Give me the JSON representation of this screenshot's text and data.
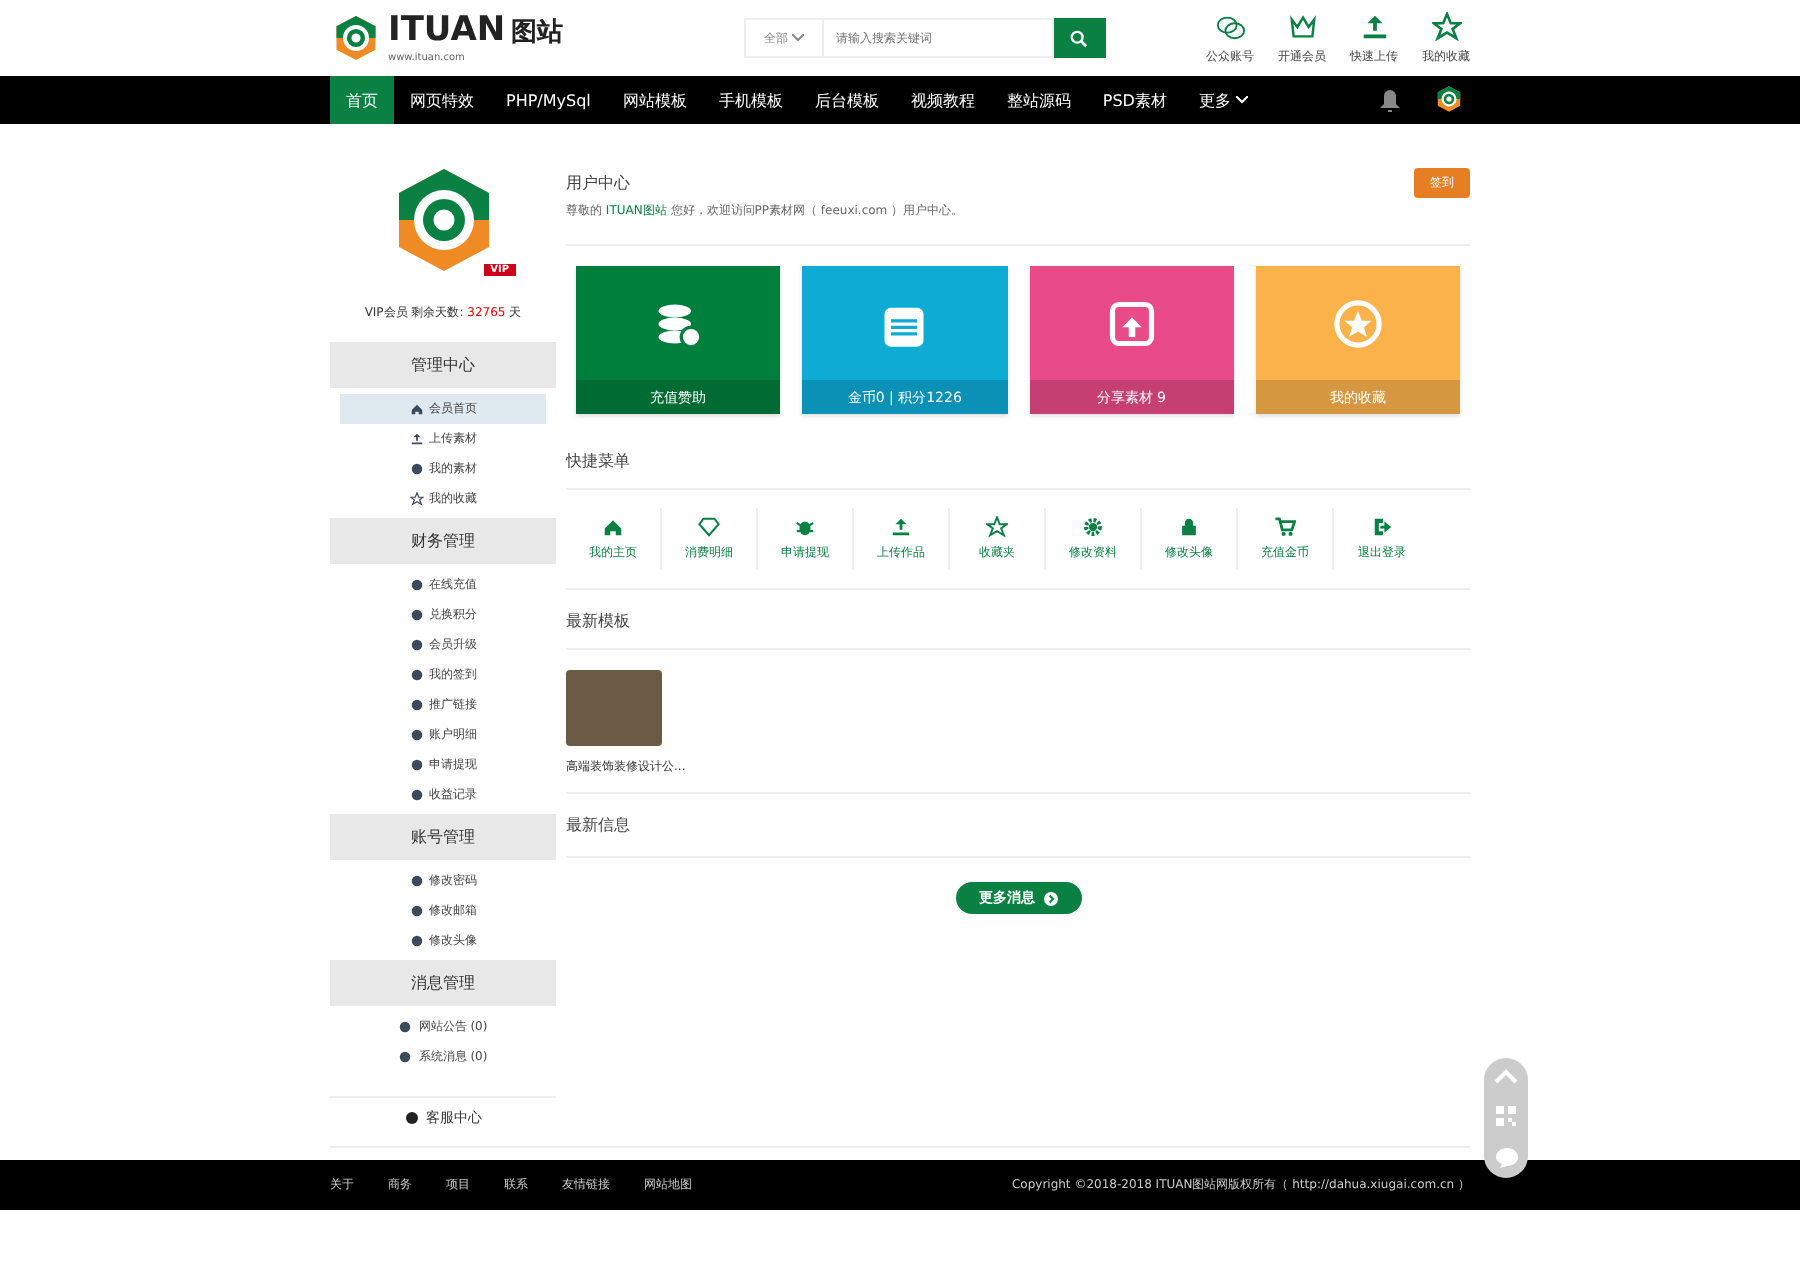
{
  "header": {
    "logo_text": "ITUAN",
    "logo_cn": "图站",
    "logo_url": "www.ituan.com",
    "search": {
      "category": "全部",
      "placeholder": "请输入搜索关键词"
    },
    "actions": [
      "公众账号",
      "开通会员",
      "快速上传",
      "我的收藏"
    ]
  },
  "nav": {
    "items": [
      {
        "label": "首页",
        "selected": true
      },
      {
        "label": "网页特效",
        "selected": false
      },
      {
        "label": "PHP/MySql",
        "selected": false
      },
      {
        "label": "网站模板",
        "selected": false
      },
      {
        "label": "手机模板",
        "selected": false
      },
      {
        "label": "后台模板",
        "selected": false
      },
      {
        "label": "视频教程",
        "selected": false
      },
      {
        "label": "整站源码",
        "selected": false
      },
      {
        "label": "PSD素材",
        "selected": false
      },
      {
        "label": "更多",
        "selected": false
      }
    ]
  },
  "profile": {
    "badge": "VIP",
    "vip_label": "VIP会员 剩余天数:",
    "days": "32765",
    "days_unit": "天"
  },
  "sidebar": [
    {
      "title": "管理中心",
      "items": [
        {
          "label": "会员首页",
          "selected": true
        },
        {
          "label": "上传素材",
          "selected": false
        },
        {
          "label": "我的素材",
          "selected": false
        },
        {
          "label": "我的收藏",
          "selected": false
        }
      ]
    },
    {
      "title": "财务管理",
      "items": [
        {
          "label": "在线充值",
          "selected": false
        },
        {
          "label": "兑换积分",
          "selected": false
        },
        {
          "label": "会员升级",
          "selected": false
        },
        {
          "label": "我的签到",
          "selected": false
        },
        {
          "label": "推广链接",
          "selected": false
        },
        {
          "label": "账户明细",
          "selected": false
        },
        {
          "label": "申请提现",
          "selected": false
        },
        {
          "label": "收益记录",
          "selected": false
        }
      ]
    },
    {
      "title": "账号管理",
      "items": [
        {
          "label": "修改密码",
          "selected": false
        },
        {
          "label": "修改邮箱",
          "selected": false
        },
        {
          "label": "修改头像",
          "selected": false
        }
      ]
    },
    {
      "title": "消息管理",
      "items": [
        {
          "label": "网站公告 (0)",
          "selected": false
        },
        {
          "label": "系统消息 (0)",
          "selected": false
        }
      ]
    }
  ],
  "support": "客服中心",
  "main": {
    "title": "用户中心",
    "checkin_button": "签到",
    "welcome_prefix": "尊敬的 ",
    "welcome_name": "ITUAN图站",
    "welcome_suffix": " 您好，欢迎访问PP素材网（ feeuxi.com ）用户中心。",
    "cards": [
      {
        "label": "充值赞助",
        "color": "#007f3c"
      },
      {
        "label": "金币0 | 积分1226",
        "color": "#0eabd5"
      },
      {
        "label": "分享素材 9",
        "color": "#e84b88"
      },
      {
        "label": "我的收藏",
        "color": "#fbb24a"
      }
    ],
    "quick_title": "快捷菜单",
    "quick": [
      "我的主页",
      "消费明细",
      "申请提现",
      "上传作品",
      "收藏夹",
      "修改资料",
      "修改头像",
      "充值金币",
      "退出登录"
    ],
    "templates_title": "最新模板",
    "templates": [
      {
        "caption": "高端装饰装修设计公..."
      }
    ],
    "news_title": "最新信息",
    "more_button": "更多消息"
  },
  "footer": {
    "links": [
      "关于",
      "商务",
      "项目",
      "联系",
      "友情链接",
      "网站地图"
    ],
    "copyright": "Copyright ©2018-2018 ITUAN图站网版权所有（ http://dahua.xiugai.com.cn ）"
  }
}
